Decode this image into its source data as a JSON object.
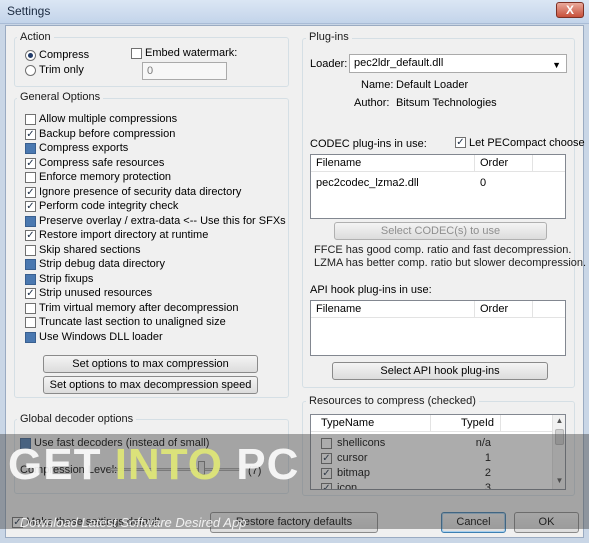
{
  "window": {
    "title": "Settings",
    "close_label": "X"
  },
  "action": {
    "title": "Action",
    "compress_label": "Compress",
    "compress_checked": true,
    "trim_label": "Trim only",
    "embed_label": "Embed watermark:",
    "watermark_value": "0"
  },
  "general": {
    "title": "General Options",
    "options": [
      {
        "label": "Allow multiple compressions",
        "state": "unchecked"
      },
      {
        "label": "Backup before compression",
        "state": "checked"
      },
      {
        "label": "Compress exports",
        "state": "filled"
      },
      {
        "label": "Compress safe resources",
        "state": "checked"
      },
      {
        "label": "Enforce memory protection",
        "state": "unchecked"
      },
      {
        "label": "Ignore presence of security data directory",
        "state": "checked"
      },
      {
        "label": "Perform code integrity check",
        "state": "checked"
      },
      {
        "label": "Preserve overlay / extra-data <-- Use this for SFXs",
        "state": "filled"
      },
      {
        "label": "Restore import directory at runtime",
        "state": "checked"
      },
      {
        "label": "Skip shared sections",
        "state": "unchecked"
      },
      {
        "label": "Strip debug data directory",
        "state": "filled"
      },
      {
        "label": "Strip fixups",
        "state": "filled"
      },
      {
        "label": "Strip unused resources",
        "state": "checked"
      },
      {
        "label": "Trim virtual memory after decompression",
        "state": "unchecked"
      },
      {
        "label": "Truncate last section to unaligned size",
        "state": "unchecked"
      },
      {
        "label": "Use Windows DLL loader",
        "state": "filled"
      }
    ],
    "max_compression_btn": "Set options to max compression",
    "max_speed_btn": "Set options to max decompression speed"
  },
  "decoder": {
    "title": "Global decoder options",
    "fast_label": "Use fast decoders (instead of small)",
    "level_label": "Compression Level:",
    "level_value": "(7)"
  },
  "footer": {
    "default_label": "Make these settings default",
    "restore_btn": "Restore factory defaults",
    "cancel_btn": "Cancel",
    "ok_btn": "OK"
  },
  "plugins": {
    "title": "Plug-ins",
    "loader_label": "Loader:",
    "loader_value": "pec2ldr_default.dll",
    "name_label": "Name:",
    "name_value": "Default Loader",
    "author_label": "Author:",
    "author_value": "Bitsum Technologies"
  },
  "codec": {
    "label": "CODEC plug-ins in use:",
    "let_choose_label": "Let PECompact choose",
    "columns": [
      "Filename",
      "Order"
    ],
    "rows": [
      {
        "filename": "pec2codec_lzma2.dll",
        "order": "0"
      }
    ],
    "select_btn": "Select CODEC(s) to use",
    "note1": "FFCE has good comp. ratio and fast decompression.",
    "note2": "LZMA has better comp. ratio but slower decompression."
  },
  "apihook": {
    "label": "API hook plug-ins in use:",
    "columns": [
      "Filename",
      "Order"
    ],
    "select_btn": "Select API hook plug-ins"
  },
  "resources": {
    "title": "Resources to compress (checked)",
    "columns": [
      "TypeName",
      "TypeId"
    ],
    "rows": [
      {
        "name": "shellicons",
        "id": "n/a",
        "checked": false
      },
      {
        "name": "cursor",
        "id": "1",
        "checked": true
      },
      {
        "name": "bitmap",
        "id": "2",
        "checked": true
      },
      {
        "name": "icon",
        "id": "3",
        "checked": true
      }
    ]
  },
  "watermark": {
    "title_part1": "GET ",
    "title_part2": "INTO",
    "title_part3": " PC",
    "subtitle": "Download Latest Software Desired App"
  },
  "colors": {
    "accent": "#4a78b0",
    "titlebar": "#c3d4ea",
    "close": "#c7503b"
  }
}
